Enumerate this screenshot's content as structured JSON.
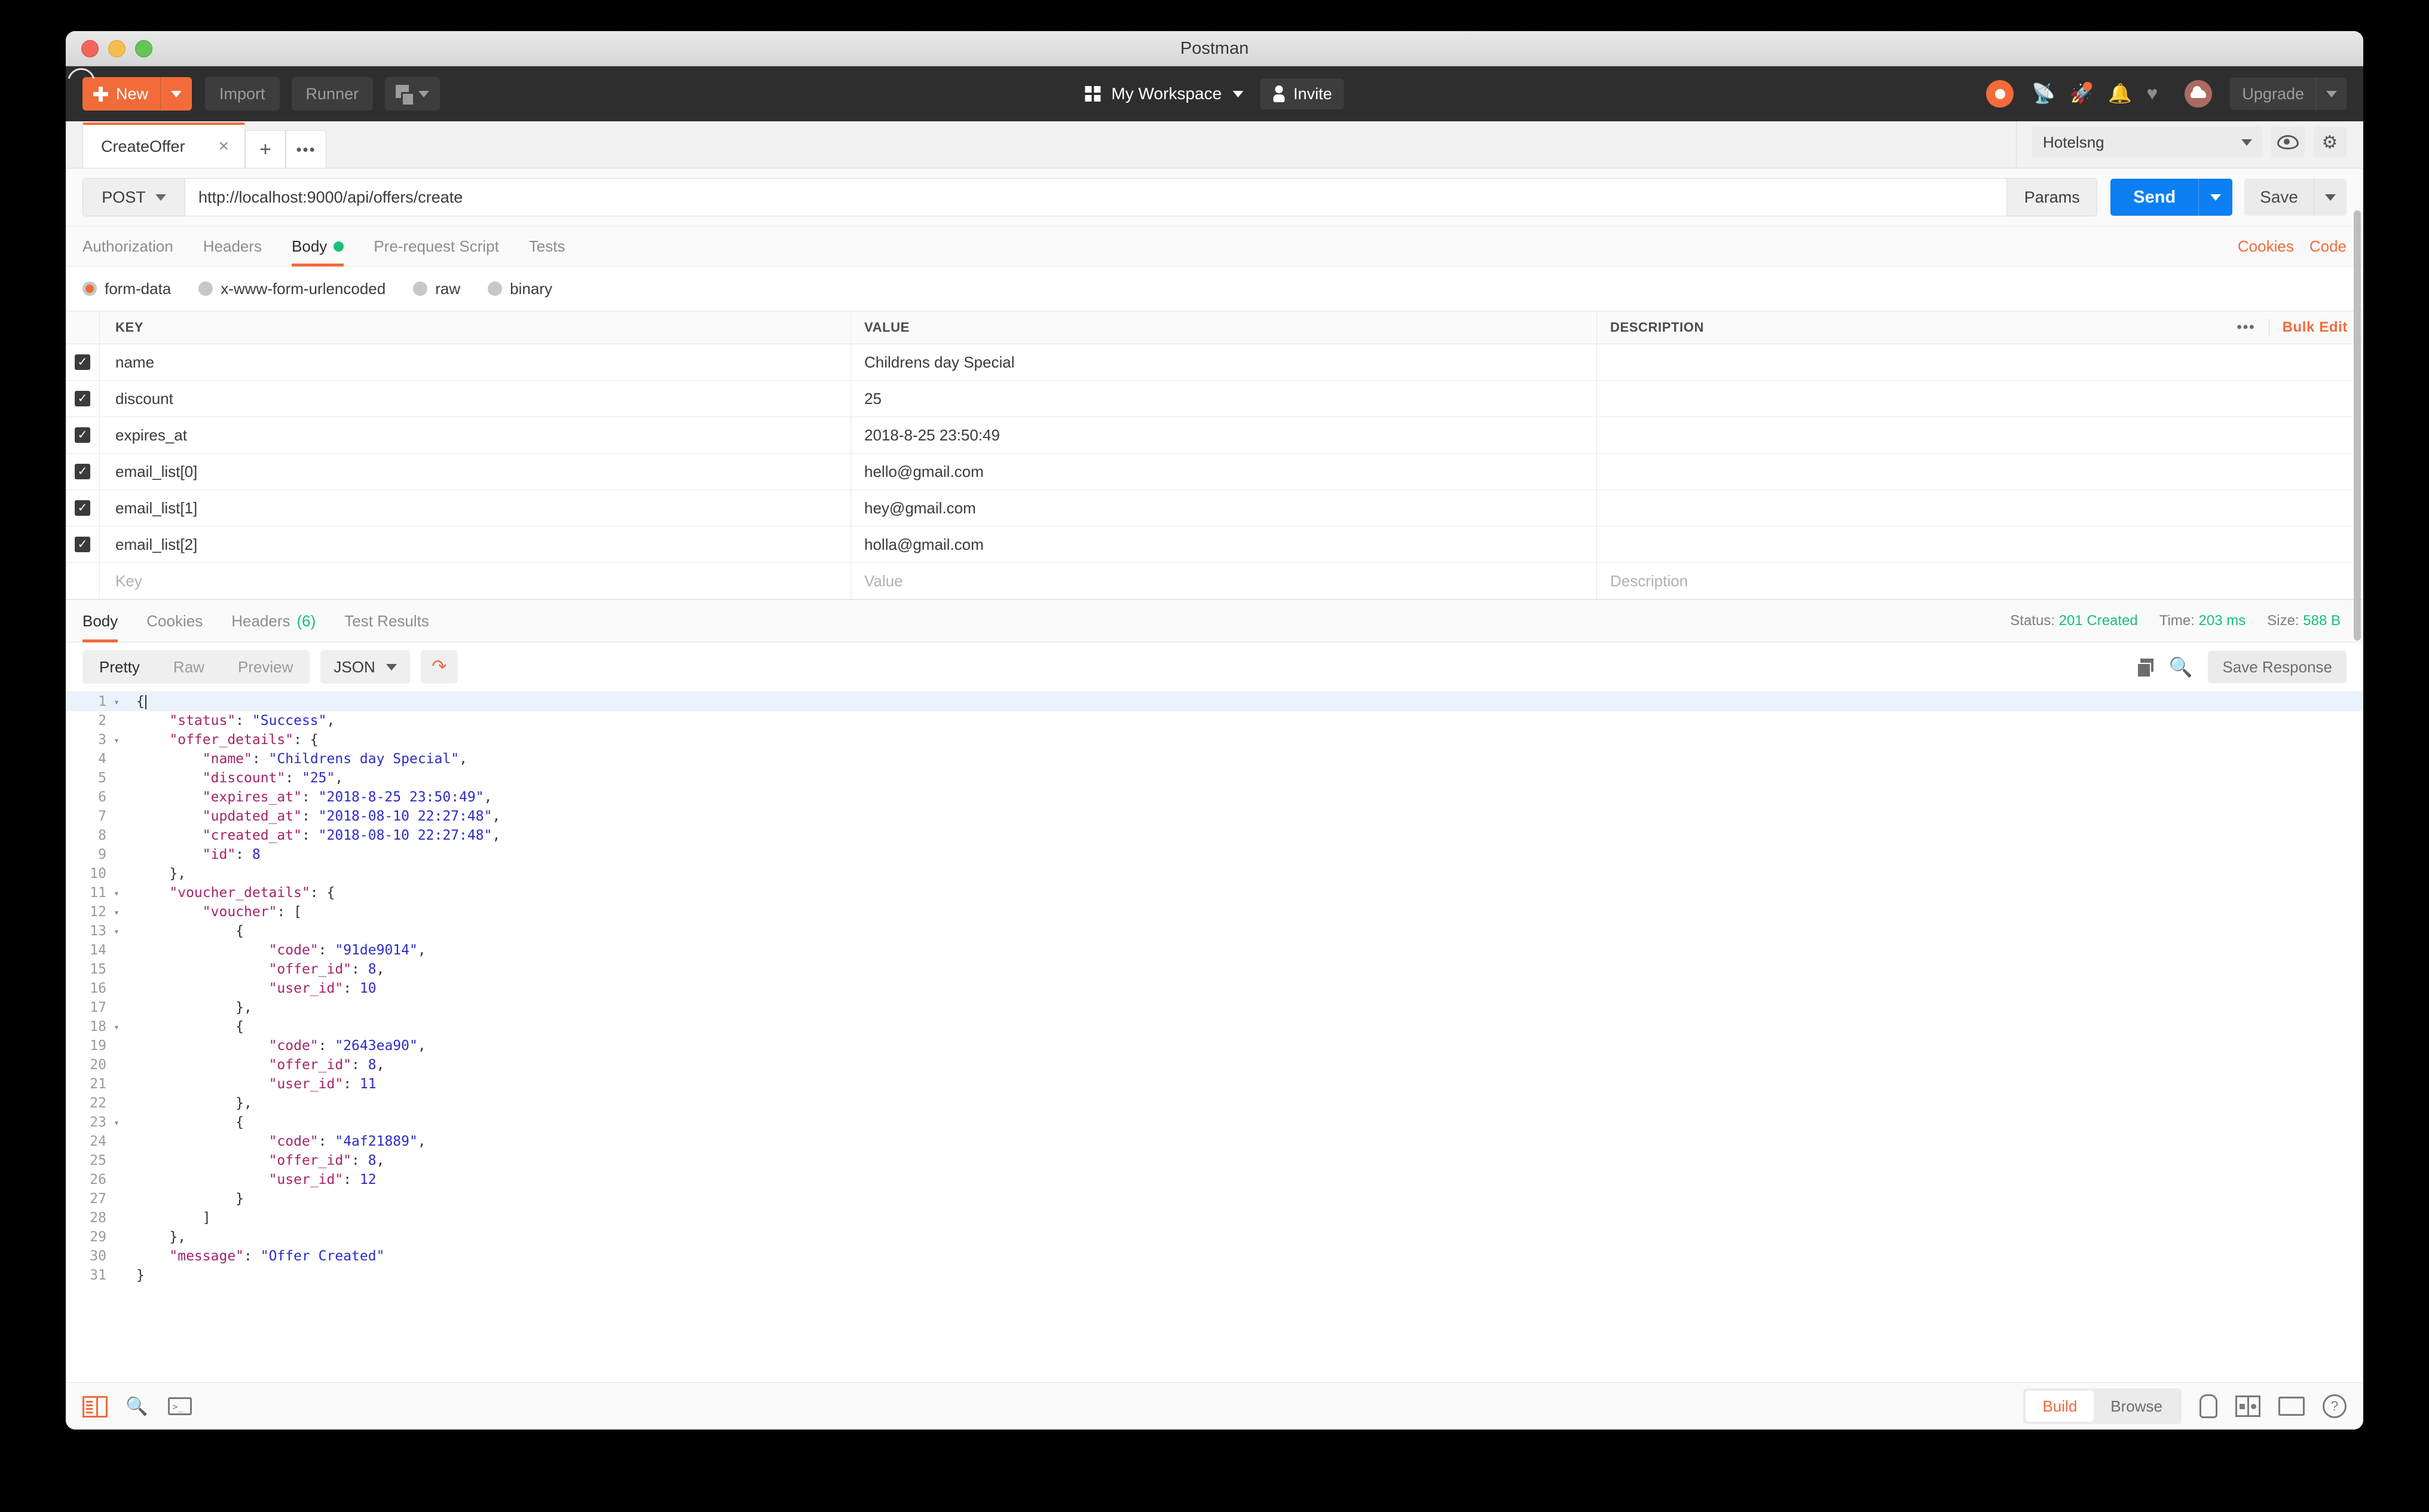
{
  "window": {
    "title": "Postman",
    "traffic_lights": [
      "close",
      "minimize",
      "zoom"
    ]
  },
  "toolbar": {
    "new_label": "New",
    "import_label": "Import",
    "runner_label": "Runner",
    "save_icon_name": "save-doc-icon",
    "workspace_label": "My Workspace",
    "invite_label": "Invite",
    "upgrade_label": "Upgrade",
    "icons": [
      "sync-icon",
      "antenna-icon",
      "rocket-icon",
      "bell-icon",
      "heart-icon",
      "avatar-cloud"
    ]
  },
  "tabstrip": {
    "tabs": [
      {
        "label": "CreateOffer",
        "close": "×",
        "active": true
      }
    ],
    "add_label": "+",
    "more_label": "•••",
    "environment": "Hotelsng",
    "eye_icon": "eye-icon",
    "gear_icon": "gear-icon"
  },
  "request": {
    "method": "POST",
    "url": "http://localhost:9000/api/offers/create",
    "params_label": "Params",
    "send_label": "Send",
    "save_label": "Save",
    "tabs": [
      {
        "label": "Authorization",
        "active": false,
        "dot": false
      },
      {
        "label": "Headers",
        "active": false,
        "dot": false
      },
      {
        "label": "Body",
        "active": true,
        "dot": true
      },
      {
        "label": "Pre-request Script",
        "active": false,
        "dot": false
      },
      {
        "label": "Tests",
        "active": false,
        "dot": false
      }
    ],
    "links": [
      "Cookies",
      "Code"
    ],
    "body_types": [
      {
        "label": "form-data",
        "selected": true
      },
      {
        "label": "x-www-form-urlencoded",
        "selected": false
      },
      {
        "label": "raw",
        "selected": false
      },
      {
        "label": "binary",
        "selected": false
      }
    ]
  },
  "form_table": {
    "columns": [
      "KEY",
      "VALUE",
      "DESCRIPTION"
    ],
    "dots_label": "•••",
    "bulk_edit_label": "Bulk Edit",
    "check_glyph": "✓",
    "rows": [
      {
        "checked": true,
        "key": "name",
        "value": "Childrens day Special",
        "description": ""
      },
      {
        "checked": true,
        "key": "discount",
        "value": "25",
        "description": ""
      },
      {
        "checked": true,
        "key": "expires_at",
        "value": "2018-8-25 23:50:49",
        "description": ""
      },
      {
        "checked": true,
        "key": "email_list[0]",
        "value": "hello@gmail.com",
        "description": ""
      },
      {
        "checked": true,
        "key": "email_list[1]",
        "value": "hey@gmail.com",
        "description": ""
      },
      {
        "checked": true,
        "key": "email_list[2]",
        "value": "holla@gmail.com",
        "description": ""
      }
    ],
    "empty_row": {
      "key": "Key",
      "value": "Value",
      "description": "Description"
    }
  },
  "response": {
    "tabs": [
      {
        "label": "Body",
        "active": true,
        "count": ""
      },
      {
        "label": "Cookies",
        "active": false,
        "count": ""
      },
      {
        "label": "Headers",
        "active": false,
        "count": "(6)"
      },
      {
        "label": "Test Results",
        "active": false,
        "count": ""
      }
    ],
    "status_label": "Status:",
    "status_value": "201 Created",
    "time_label": "Time:",
    "time_value": "203 ms",
    "size_label": "Size:",
    "size_value": "588 B",
    "view_modes": [
      {
        "label": "Pretty",
        "active": true
      },
      {
        "label": "Raw",
        "active": false
      },
      {
        "label": "Preview",
        "active": false
      }
    ],
    "format": "JSON",
    "wrap_icon": "word-wrap-icon",
    "copy_icon": "copy-icon",
    "search_icon": "search-icon",
    "save_response_label": "Save Response"
  },
  "code": {
    "language": "json",
    "lines": [
      {
        "n": 1,
        "fold": true,
        "indent": 0,
        "tokens": [
          {
            "t": "pun",
            "v": "{"
          }
        ],
        "caret": true
      },
      {
        "n": 2,
        "fold": false,
        "indent": 1,
        "tokens": [
          {
            "t": "key",
            "v": "\"status\""
          },
          {
            "t": "pun",
            "v": ": "
          },
          {
            "t": "str",
            "v": "\"Success\""
          },
          {
            "t": "pun",
            "v": ","
          }
        ]
      },
      {
        "n": 3,
        "fold": true,
        "indent": 1,
        "tokens": [
          {
            "t": "key",
            "v": "\"offer_details\""
          },
          {
            "t": "pun",
            "v": ": {"
          }
        ]
      },
      {
        "n": 4,
        "fold": false,
        "indent": 2,
        "tokens": [
          {
            "t": "key",
            "v": "\"name\""
          },
          {
            "t": "pun",
            "v": ": "
          },
          {
            "t": "str",
            "v": "\"Childrens day Special\""
          },
          {
            "t": "pun",
            "v": ","
          }
        ]
      },
      {
        "n": 5,
        "fold": false,
        "indent": 2,
        "tokens": [
          {
            "t": "key",
            "v": "\"discount\""
          },
          {
            "t": "pun",
            "v": ": "
          },
          {
            "t": "str",
            "v": "\"25\""
          },
          {
            "t": "pun",
            "v": ","
          }
        ]
      },
      {
        "n": 6,
        "fold": false,
        "indent": 2,
        "tokens": [
          {
            "t": "key",
            "v": "\"expires_at\""
          },
          {
            "t": "pun",
            "v": ": "
          },
          {
            "t": "str",
            "v": "\"2018-8-25 23:50:49\""
          },
          {
            "t": "pun",
            "v": ","
          }
        ]
      },
      {
        "n": 7,
        "fold": false,
        "indent": 2,
        "tokens": [
          {
            "t": "key",
            "v": "\"updated_at\""
          },
          {
            "t": "pun",
            "v": ": "
          },
          {
            "t": "str",
            "v": "\"2018-08-10 22:27:48\""
          },
          {
            "t": "pun",
            "v": ","
          }
        ]
      },
      {
        "n": 8,
        "fold": false,
        "indent": 2,
        "tokens": [
          {
            "t": "key",
            "v": "\"created_at\""
          },
          {
            "t": "pun",
            "v": ": "
          },
          {
            "t": "str",
            "v": "\"2018-08-10 22:27:48\""
          },
          {
            "t": "pun",
            "v": ","
          }
        ]
      },
      {
        "n": 9,
        "fold": false,
        "indent": 2,
        "tokens": [
          {
            "t": "key",
            "v": "\"id\""
          },
          {
            "t": "pun",
            "v": ": "
          },
          {
            "t": "num",
            "v": "8"
          }
        ]
      },
      {
        "n": 10,
        "fold": false,
        "indent": 1,
        "tokens": [
          {
            "t": "pun",
            "v": "},"
          }
        ]
      },
      {
        "n": 11,
        "fold": true,
        "indent": 1,
        "tokens": [
          {
            "t": "key",
            "v": "\"voucher_details\""
          },
          {
            "t": "pun",
            "v": ": {"
          }
        ]
      },
      {
        "n": 12,
        "fold": true,
        "indent": 2,
        "tokens": [
          {
            "t": "key",
            "v": "\"voucher\""
          },
          {
            "t": "pun",
            "v": ": ["
          }
        ]
      },
      {
        "n": 13,
        "fold": true,
        "indent": 3,
        "tokens": [
          {
            "t": "pun",
            "v": "{"
          }
        ]
      },
      {
        "n": 14,
        "fold": false,
        "indent": 4,
        "tokens": [
          {
            "t": "key",
            "v": "\"code\""
          },
          {
            "t": "pun",
            "v": ": "
          },
          {
            "t": "str",
            "v": "\"91de9014\""
          },
          {
            "t": "pun",
            "v": ","
          }
        ]
      },
      {
        "n": 15,
        "fold": false,
        "indent": 4,
        "tokens": [
          {
            "t": "key",
            "v": "\"offer_id\""
          },
          {
            "t": "pun",
            "v": ": "
          },
          {
            "t": "num",
            "v": "8"
          },
          {
            "t": "pun",
            "v": ","
          }
        ]
      },
      {
        "n": 16,
        "fold": false,
        "indent": 4,
        "tokens": [
          {
            "t": "key",
            "v": "\"user_id\""
          },
          {
            "t": "pun",
            "v": ": "
          },
          {
            "t": "num",
            "v": "10"
          }
        ]
      },
      {
        "n": 17,
        "fold": false,
        "indent": 3,
        "tokens": [
          {
            "t": "pun",
            "v": "},"
          }
        ]
      },
      {
        "n": 18,
        "fold": true,
        "indent": 3,
        "tokens": [
          {
            "t": "pun",
            "v": "{"
          }
        ]
      },
      {
        "n": 19,
        "fold": false,
        "indent": 4,
        "tokens": [
          {
            "t": "key",
            "v": "\"code\""
          },
          {
            "t": "pun",
            "v": ": "
          },
          {
            "t": "str",
            "v": "\"2643ea90\""
          },
          {
            "t": "pun",
            "v": ","
          }
        ]
      },
      {
        "n": 20,
        "fold": false,
        "indent": 4,
        "tokens": [
          {
            "t": "key",
            "v": "\"offer_id\""
          },
          {
            "t": "pun",
            "v": ": "
          },
          {
            "t": "num",
            "v": "8"
          },
          {
            "t": "pun",
            "v": ","
          }
        ]
      },
      {
        "n": 21,
        "fold": false,
        "indent": 4,
        "tokens": [
          {
            "t": "key",
            "v": "\"user_id\""
          },
          {
            "t": "pun",
            "v": ": "
          },
          {
            "t": "num",
            "v": "11"
          }
        ]
      },
      {
        "n": 22,
        "fold": false,
        "indent": 3,
        "tokens": [
          {
            "t": "pun",
            "v": "},"
          }
        ]
      },
      {
        "n": 23,
        "fold": true,
        "indent": 3,
        "tokens": [
          {
            "t": "pun",
            "v": "{"
          }
        ]
      },
      {
        "n": 24,
        "fold": false,
        "indent": 4,
        "tokens": [
          {
            "t": "key",
            "v": "\"code\""
          },
          {
            "t": "pun",
            "v": ": "
          },
          {
            "t": "str",
            "v": "\"4af21889\""
          },
          {
            "t": "pun",
            "v": ","
          }
        ]
      },
      {
        "n": 25,
        "fold": false,
        "indent": 4,
        "tokens": [
          {
            "t": "key",
            "v": "\"offer_id\""
          },
          {
            "t": "pun",
            "v": ": "
          },
          {
            "t": "num",
            "v": "8"
          },
          {
            "t": "pun",
            "v": ","
          }
        ]
      },
      {
        "n": 26,
        "fold": false,
        "indent": 4,
        "tokens": [
          {
            "t": "key",
            "v": "\"user_id\""
          },
          {
            "t": "pun",
            "v": ": "
          },
          {
            "t": "num",
            "v": "12"
          }
        ]
      },
      {
        "n": 27,
        "fold": false,
        "indent": 3,
        "tokens": [
          {
            "t": "pun",
            "v": "}"
          }
        ]
      },
      {
        "n": 28,
        "fold": false,
        "indent": 2,
        "tokens": [
          {
            "t": "pun",
            "v": "]"
          }
        ]
      },
      {
        "n": 29,
        "fold": false,
        "indent": 1,
        "tokens": [
          {
            "t": "pun",
            "v": "},"
          }
        ]
      },
      {
        "n": 30,
        "fold": false,
        "indent": 1,
        "tokens": [
          {
            "t": "key",
            "v": "\"message\""
          },
          {
            "t": "pun",
            "v": ": "
          },
          {
            "t": "str",
            "v": "\"Offer Created\""
          }
        ]
      },
      {
        "n": 31,
        "fold": false,
        "indent": 0,
        "tokens": [
          {
            "t": "pun",
            "v": "}"
          }
        ]
      }
    ]
  },
  "bottombar": {
    "left_icons": [
      "sidebar-toggle-icon",
      "find-icon",
      "console-icon"
    ],
    "modes": [
      {
        "label": "Build",
        "active": true
      },
      {
        "label": "Browse",
        "active": false
      }
    ],
    "right_icons": [
      "bulb-icon",
      "two-pane-icon",
      "keyboard-icon",
      "help-icon"
    ]
  },
  "colors": {
    "accent_orange": "#f26b3a",
    "send_blue": "#0c7ff2",
    "success_green": "#18c07b",
    "dark_chrome": "#2e2e2e"
  }
}
